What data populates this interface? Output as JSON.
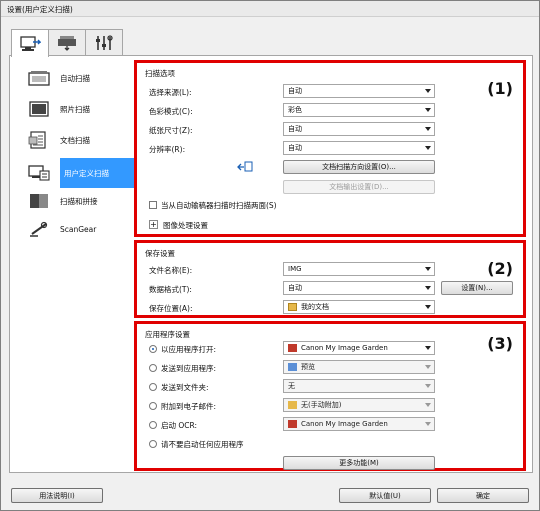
{
  "window": {
    "title": "设置(用户定义扫描)"
  },
  "tabs": [
    {
      "icon": "scan-from-computer-icon"
    },
    {
      "icon": "scan-from-panel-icon"
    },
    {
      "icon": "general-settings-icon"
    }
  ],
  "sidebar": {
    "items": [
      {
        "label": "自动扫描",
        "icon": "auto-scan-icon"
      },
      {
        "label": "照片扫描",
        "icon": "photo-scan-icon"
      },
      {
        "label": "文档扫描",
        "icon": "document-scan-icon"
      },
      {
        "label": "用户定义扫描",
        "icon": "custom-scan-icon",
        "selected": true
      },
      {
        "label": "扫描和拼接",
        "icon": "scan-stitch-icon"
      },
      {
        "label": "ScanGear",
        "icon": "scangear-icon"
      }
    ]
  },
  "section1": {
    "title": "扫描选项",
    "number": "(1)",
    "rows": [
      {
        "label": "选择来源(L):",
        "value": "自动"
      },
      {
        "label": "色彩模式(C):",
        "value": "彩色"
      },
      {
        "label": "纸张尺寸(Z):",
        "value": "自动"
      },
      {
        "label": "分辨率(R):",
        "value": "自动"
      }
    ],
    "orientation_button": "文档扫描方向设置(O)...",
    "output_button": "文档输出设置(D)...",
    "checkbox_label": "当从自动输稿器扫描时扫描两面(S)",
    "expand_label": "图像处理设置"
  },
  "section2": {
    "title": "保存设置",
    "number": "(2)",
    "file_name_label": "文件名称(E):",
    "file_name_value": "IMG",
    "data_format_label": "数据格式(T):",
    "data_format_value": "自动",
    "settings_button": "设置(N)...",
    "save_in_label": "保存位置(A):",
    "save_in_value": "我的文档"
  },
  "section3": {
    "title": "应用程序设置",
    "number": "(3)",
    "options": [
      {
        "label": "以应用程序打开:",
        "value": "Canon My Image Garden",
        "checked": true,
        "disabled": false,
        "icon": "image-garden-icon"
      },
      {
        "label": "发送到应用程序:",
        "value": "预览",
        "checked": false,
        "disabled": true,
        "icon": "preview-icon"
      },
      {
        "label": "发送到文件夹:",
        "value": "无",
        "checked": false,
        "disabled": true,
        "icon": ""
      },
      {
        "label": "附加到电子邮件:",
        "value": "无(手动附加)",
        "checked": false,
        "disabled": true,
        "icon": "email-icon"
      },
      {
        "label": "启动 OCR:",
        "value": "Canon My Image Garden",
        "checked": false,
        "disabled": true,
        "icon": "image-garden-icon"
      },
      {
        "label": "请不要启动任何应用程序",
        "checked": false
      }
    ],
    "more_button": "更多功能(M)"
  },
  "footer": {
    "help_button": "用法说明(I)",
    "defaults_button": "默认值(U)",
    "ok_button": "确定"
  },
  "colors": {
    "highlight": "#e00000",
    "selected": "#3399ff"
  }
}
